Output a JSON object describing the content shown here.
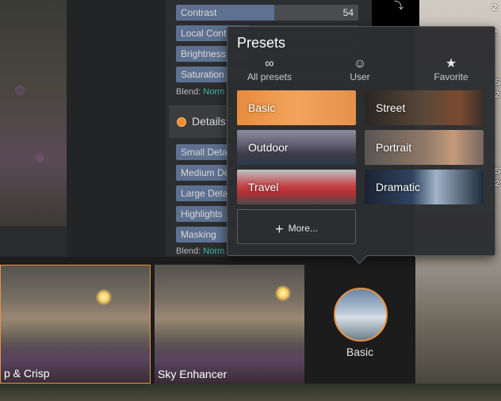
{
  "adjustments": {
    "sliders": [
      {
        "label": "Contrast",
        "value": "54",
        "fill": 0.54
      },
      {
        "label": "Local Contr",
        "value": "",
        "fill": 0.4
      },
      {
        "label": "Brightness",
        "value": "",
        "fill": 0.4
      },
      {
        "label": "Saturation",
        "value": "",
        "fill": 0.4
      }
    ],
    "blend_label": "Blend:",
    "blend_mode": "Norm",
    "details_title": "Details",
    "detail_sliders": [
      {
        "label": "Small Detai"
      },
      {
        "label": "Medium De"
      },
      {
        "label": "Large Deta"
      },
      {
        "label": "Highlights"
      },
      {
        "label": "Masking"
      }
    ],
    "blend_mode_2": "Norm"
  },
  "right_labels": [
    "2",
    "2",
    "S",
    "2",
    "S",
    "2"
  ],
  "presets_popover": {
    "title": "Presets",
    "tabs": [
      {
        "icon": "infinity-icon",
        "glyph": "∞",
        "label": "All presets"
      },
      {
        "icon": "user-icon",
        "glyph": "☺",
        "label": "User"
      },
      {
        "icon": "star-icon",
        "glyph": "★",
        "label": "Favorite"
      }
    ],
    "tiles": [
      "Basic",
      "Street",
      "Outdoor",
      "Portrait",
      "Travel",
      "Dramatic"
    ],
    "more_label": "More...",
    "more_glyph": "+"
  },
  "filmstrip": {
    "thumbs": [
      {
        "label": "p & Crisp"
      },
      {
        "label": "Sky Enhancer"
      }
    ],
    "current_preset": "Basic"
  },
  "colors": {
    "accent": "#e89342",
    "blend_mode": "#3fb7a6",
    "slider_fill": "#5e7190"
  }
}
